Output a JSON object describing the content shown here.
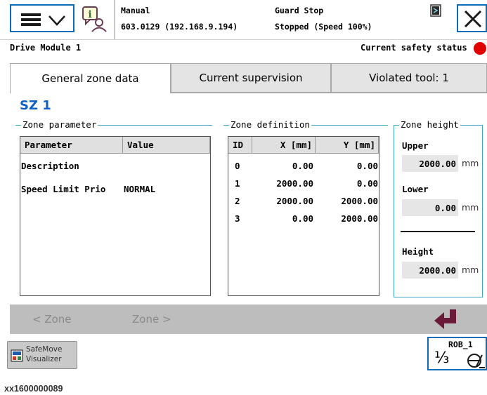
{
  "header": {
    "mode": "Manual",
    "controller": "603.0129 (192.168.9.194)",
    "guard": "Guard Stop",
    "state": "Stopped (Speed 100%)"
  },
  "drive_module": "Drive Module 1",
  "safety_status_label": "Current safety status",
  "safety_status_color": "#e00000",
  "accent_color": "#0b6bb5",
  "zone_title_color": "#1060c0",
  "tabs": [
    {
      "label": "General zone data",
      "active": true
    },
    {
      "label": "Current supervision",
      "active": false
    },
    {
      "label": "Violated tool: 1",
      "active": false
    }
  ],
  "zone_title": "SZ 1",
  "zone_parameter": {
    "title": "Zone parameter",
    "headers": [
      "Parameter",
      "Value"
    ],
    "rows": [
      [
        "Description",
        ""
      ],
      [
        "Speed Limit Prio",
        "NORMAL"
      ]
    ]
  },
  "zone_definition": {
    "title": "Zone definition",
    "headers": [
      "ID",
      "X [mm]",
      "Y [mm]"
    ],
    "rows": [
      [
        "0",
        "0.00",
        "0.00"
      ],
      [
        "1",
        "2000.00",
        "0.00"
      ],
      [
        "2",
        "2000.00",
        "2000.00"
      ],
      [
        "3",
        "0.00",
        "2000.00"
      ]
    ]
  },
  "zone_height": {
    "title": "Zone height",
    "upper_label": "Upper",
    "upper_value": "2000.00",
    "lower_label": "Lower",
    "lower_value": "0.00",
    "height_label": "Height",
    "height_value": "2000.00",
    "unit": "mm"
  },
  "nav": {
    "prev": "< Zone",
    "next": "Zone >",
    "back_icon": "return-arrow-icon"
  },
  "safemove_button": {
    "line1": "SafeMove",
    "line2": "Visualizer"
  },
  "rob_button": {
    "label": "ROB_1",
    "fraction": "⅓"
  },
  "caption": "xx1600000089"
}
